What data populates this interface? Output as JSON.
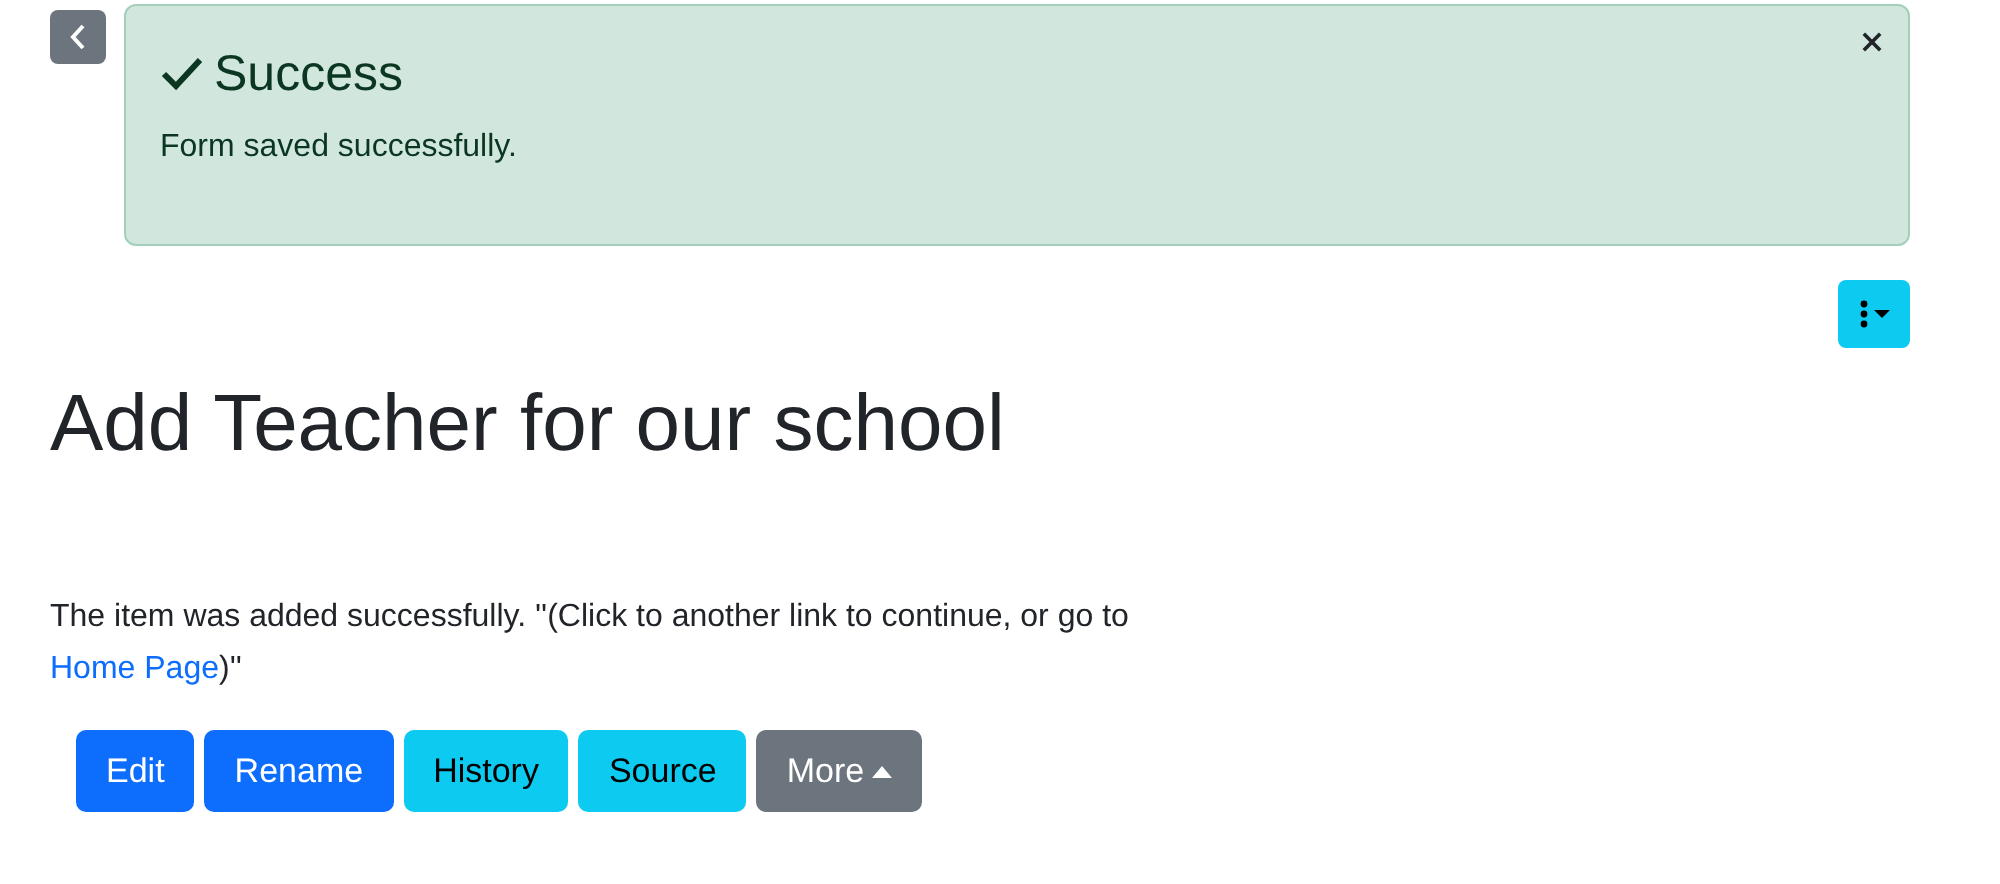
{
  "alert": {
    "title": "Success",
    "message": "Form saved successfully."
  },
  "page_title": "Add Teacher for our school",
  "message": {
    "text_before": "The item was added successfully. ''(Click to another link to continue, or go to",
    "link": "Home Page",
    "text_after": ")''"
  },
  "buttons": [
    {
      "label": "Edit",
      "kind": "primary"
    },
    {
      "label": "Rename",
      "kind": "primary"
    },
    {
      "label": "History",
      "kind": "info"
    },
    {
      "label": "Source",
      "kind": "info"
    },
    {
      "label": "More",
      "kind": "secondary"
    }
  ]
}
